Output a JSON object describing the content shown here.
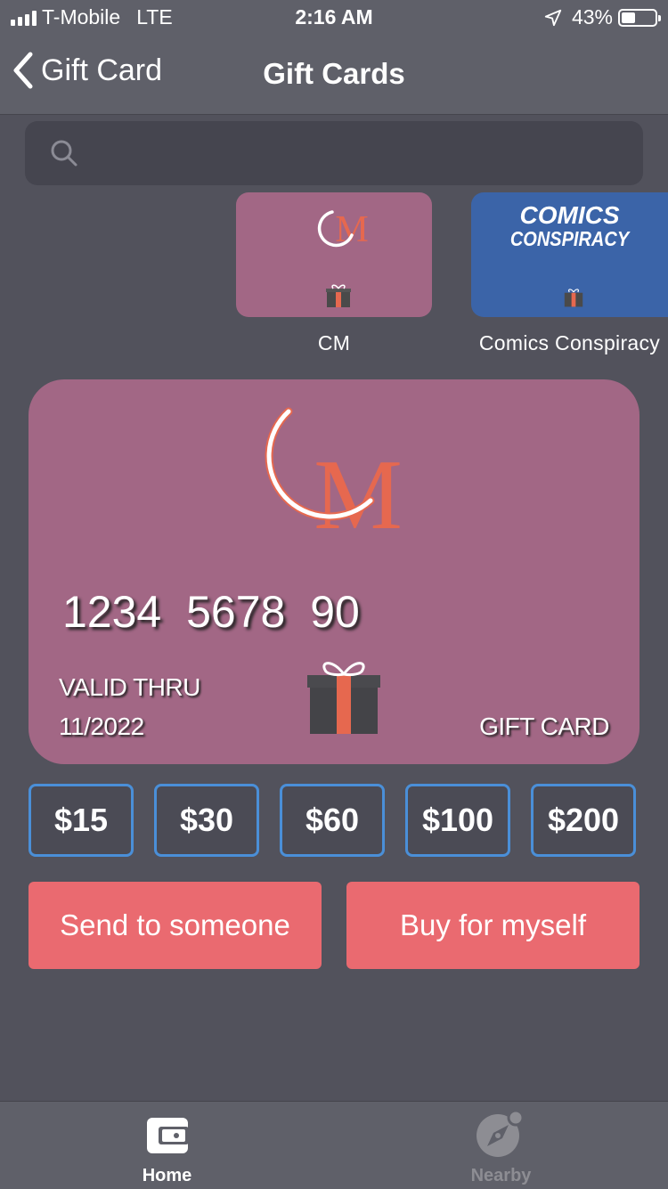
{
  "status_bar": {
    "carrier": "T-Mobile",
    "network": "LTE",
    "time": "2:16 AM",
    "battery": "43%",
    "battery_level": 0.43
  },
  "nav": {
    "back_label": "Gift Card",
    "title": "Gift Cards"
  },
  "search": {
    "placeholder": ""
  },
  "thumbnails": [
    {
      "label": "CM",
      "logo": "M"
    },
    {
      "label": "Comics Conspiracy",
      "logo_line1": "COMICS",
      "logo_line2": "CONSPIRACY"
    }
  ],
  "card": {
    "logo_letter": "M",
    "number": "1234  5678  90",
    "valid_label": "VALID THRU",
    "valid_date": "11/2022",
    "type_label": "GIFT CARD"
  },
  "amounts": [
    "$15",
    "$30",
    "$60",
    "$100",
    "$200"
  ],
  "actions": {
    "send": "Send to someone",
    "buy": "Buy for myself"
  },
  "tabs": [
    {
      "label": "Home",
      "icon": "wallet-icon",
      "active": true
    },
    {
      "label": "Nearby",
      "icon": "compass-icon",
      "active": false
    }
  ],
  "colors": {
    "card": "#a26785",
    "comics_card": "#3b64a8",
    "accent_orange": "#e6684f",
    "action_button": "#ea6a70",
    "amount_border": "#4a8fd8"
  }
}
